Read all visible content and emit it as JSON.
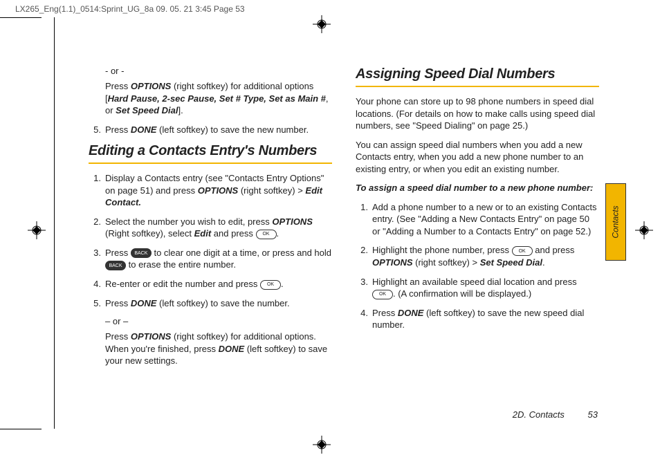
{
  "header_slug": "LX265_Eng(1.1)_0514:Sprint_UG_8a  09. 05. 21    3:45  Page 53",
  "side_tab": "Contacts",
  "footer": {
    "section": "2D. Contacts",
    "page": "53"
  },
  "left": {
    "intro_or": "- or -",
    "intro_text": {
      "a": "Press ",
      "b": "OPTIONS",
      "c": " (right softkey) for additional options [",
      "d": "Hard Pause, 2-sec Pause, Set # Type, Set as Main #",
      "e": ", or ",
      "f": "Set Speed Dial",
      "g": "]."
    },
    "step5": {
      "num": "5.",
      "a": "Press ",
      "b": "DONE",
      "c": " (left softkey) to save the new number."
    },
    "heading": "Editing a Contacts Entry's Numbers",
    "steps": [
      {
        "num": "1.",
        "a": "Display a Contacts entry (see \"Contacts Entry Options\" on page 51) and press ",
        "b": "OPTIONS",
        "c": " (right softkey) ",
        "gt": ">",
        "d": " Edit Contact."
      },
      {
        "num": "2.",
        "a": "Select the number you wish to edit, press ",
        "b": "OPTIONS",
        "c": " (Right softkey), select ",
        "d": "Edit",
        "e": " and press ",
        "key": "OK",
        "f": "."
      },
      {
        "num": "3.",
        "a": "Press ",
        "key1": "BACK",
        "b": " to clear one digit at a time, or press and hold ",
        "key2": "BACK",
        "c": " to erase the entire number."
      },
      {
        "num": "4.",
        "a": "Re-enter or edit the number and press ",
        "key": "OK",
        "b": "."
      },
      {
        "num": "5.",
        "a": "Press ",
        "b": "DONE",
        "c": " (left softkey) to save the number."
      }
    ],
    "or2": "– or –",
    "tail": {
      "a": "Press ",
      "b": "OPTIONS",
      "c": " (right softkey) for additional options. When you're finished, press ",
      "d": "DONE",
      "e": " (left softkey) to save your new settings."
    }
  },
  "right": {
    "heading": "Assigning Speed Dial Numbers",
    "p1": "Your phone can store up to 98 phone numbers in speed dial locations. (For details on how to make calls using speed dial numbers, see \"Speed Dialing\" on page 25.)",
    "p2": "You can assign speed dial numbers when you add a new Contacts entry, when you add a new phone number to an existing entry, or when you edit an existing number.",
    "instr_head": "To assign a speed dial number to a new phone number:",
    "steps": [
      {
        "num": "1.",
        "a": "Add a phone number to a new or to an existing Contacts entry. (See \"Adding a New Contacts Entry\" on page 50 or \"Adding a Number to a Contacts Entry\" on page 52.)"
      },
      {
        "num": "2.",
        "a": "Highlight the phone number, press ",
        "key": "OK",
        "b": " and press ",
        "c": "OPTIONS",
        "d": " (right softkey) ",
        "gt": ">",
        "e": " Set Speed Dial",
        "f": "."
      },
      {
        "num": "3.",
        "a": "Highlight an available speed dial location and press ",
        "key": "OK",
        "b": ". (A confirmation will be displayed.)"
      },
      {
        "num": "4.",
        "a": "Press ",
        "b": "DONE",
        "c": " (left softkey) to save the new speed dial number."
      }
    ]
  }
}
